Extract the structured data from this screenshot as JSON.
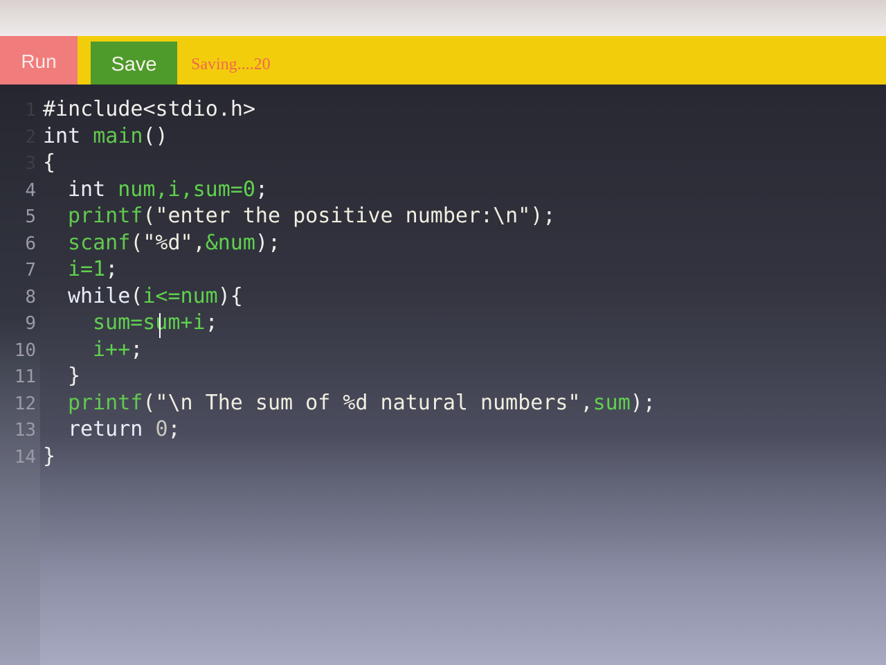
{
  "toolbar": {
    "run_label": "Run",
    "save_label": "Save",
    "status_text": "Saving....20",
    "colors": {
      "bar": "#f2cd0c",
      "run": "#f07c7c",
      "save": "#4e9a2b",
      "status": "#f06a4c"
    }
  },
  "editor": {
    "background": "#2a2a33",
    "lines": [
      {
        "no": "1",
        "indent": 0,
        "parts": [
          {
            "t": "#include<stdio.h>",
            "c": "txt"
          }
        ]
      },
      {
        "no": "2",
        "indent": 0,
        "parts": [
          {
            "t": "int ",
            "c": "kw"
          },
          {
            "t": "main",
            "c": "fn"
          },
          {
            "t": "()",
            "c": "txt"
          }
        ]
      },
      {
        "no": "3",
        "indent": 0,
        "parts": [
          {
            "t": "{",
            "c": "txt"
          }
        ]
      },
      {
        "no": "4",
        "indent": 1,
        "parts": [
          {
            "t": "int ",
            "c": "kw"
          },
          {
            "t": "num,i,sum=0",
            "c": "grn"
          },
          {
            "t": ";",
            "c": "txt"
          }
        ]
      },
      {
        "no": "5",
        "indent": 1,
        "parts": [
          {
            "t": "printf",
            "c": "fn"
          },
          {
            "t": "(\"enter the positive number:\\n\");",
            "c": "str"
          }
        ]
      },
      {
        "no": "6",
        "indent": 1,
        "parts": [
          {
            "t": "scanf",
            "c": "fn"
          },
          {
            "t": "(\"%d\",",
            "c": "str"
          },
          {
            "t": "&num",
            "c": "grn"
          },
          {
            "t": ");",
            "c": "txt"
          }
        ]
      },
      {
        "no": "7",
        "indent": 1,
        "parts": [
          {
            "t": "i=1",
            "c": "grn"
          },
          {
            "t": ";",
            "c": "txt"
          }
        ]
      },
      {
        "no": "8",
        "indent": 1,
        "parts": [
          {
            "t": "while",
            "c": "kw"
          },
          {
            "t": "(",
            "c": "txt"
          },
          {
            "t": "i<=num",
            "c": "grn"
          },
          {
            "t": "){",
            "c": "txt"
          }
        ]
      },
      {
        "no": "9",
        "indent": 2,
        "parts": [
          {
            "t": "sum=sum+i",
            "c": "grn"
          },
          {
            "t": ";",
            "c": "txt"
          }
        ]
      },
      {
        "no": "10",
        "indent": 2,
        "parts": [
          {
            "t": "i++",
            "c": "grn"
          },
          {
            "t": ";",
            "c": "txt"
          }
        ]
      },
      {
        "no": "11",
        "indent": 1,
        "parts": [
          {
            "t": "}",
            "c": "txt"
          }
        ]
      },
      {
        "no": "12",
        "indent": 1,
        "parts": [
          {
            "t": "printf",
            "c": "fn"
          },
          {
            "t": "(\"\\n The sum of %d natural numbers\",",
            "c": "str"
          },
          {
            "t": "sum",
            "c": "grn"
          },
          {
            "t": ");",
            "c": "txt"
          }
        ]
      },
      {
        "no": "13",
        "indent": 1,
        "parts": [
          {
            "t": "return ",
            "c": "kw"
          },
          {
            "t": "0",
            "c": "num"
          },
          {
            "t": ";",
            "c": "txt"
          }
        ]
      },
      {
        "no": "14",
        "indent": 0,
        "parts": [
          {
            "t": "}",
            "c": "txt"
          }
        ]
      }
    ]
  }
}
